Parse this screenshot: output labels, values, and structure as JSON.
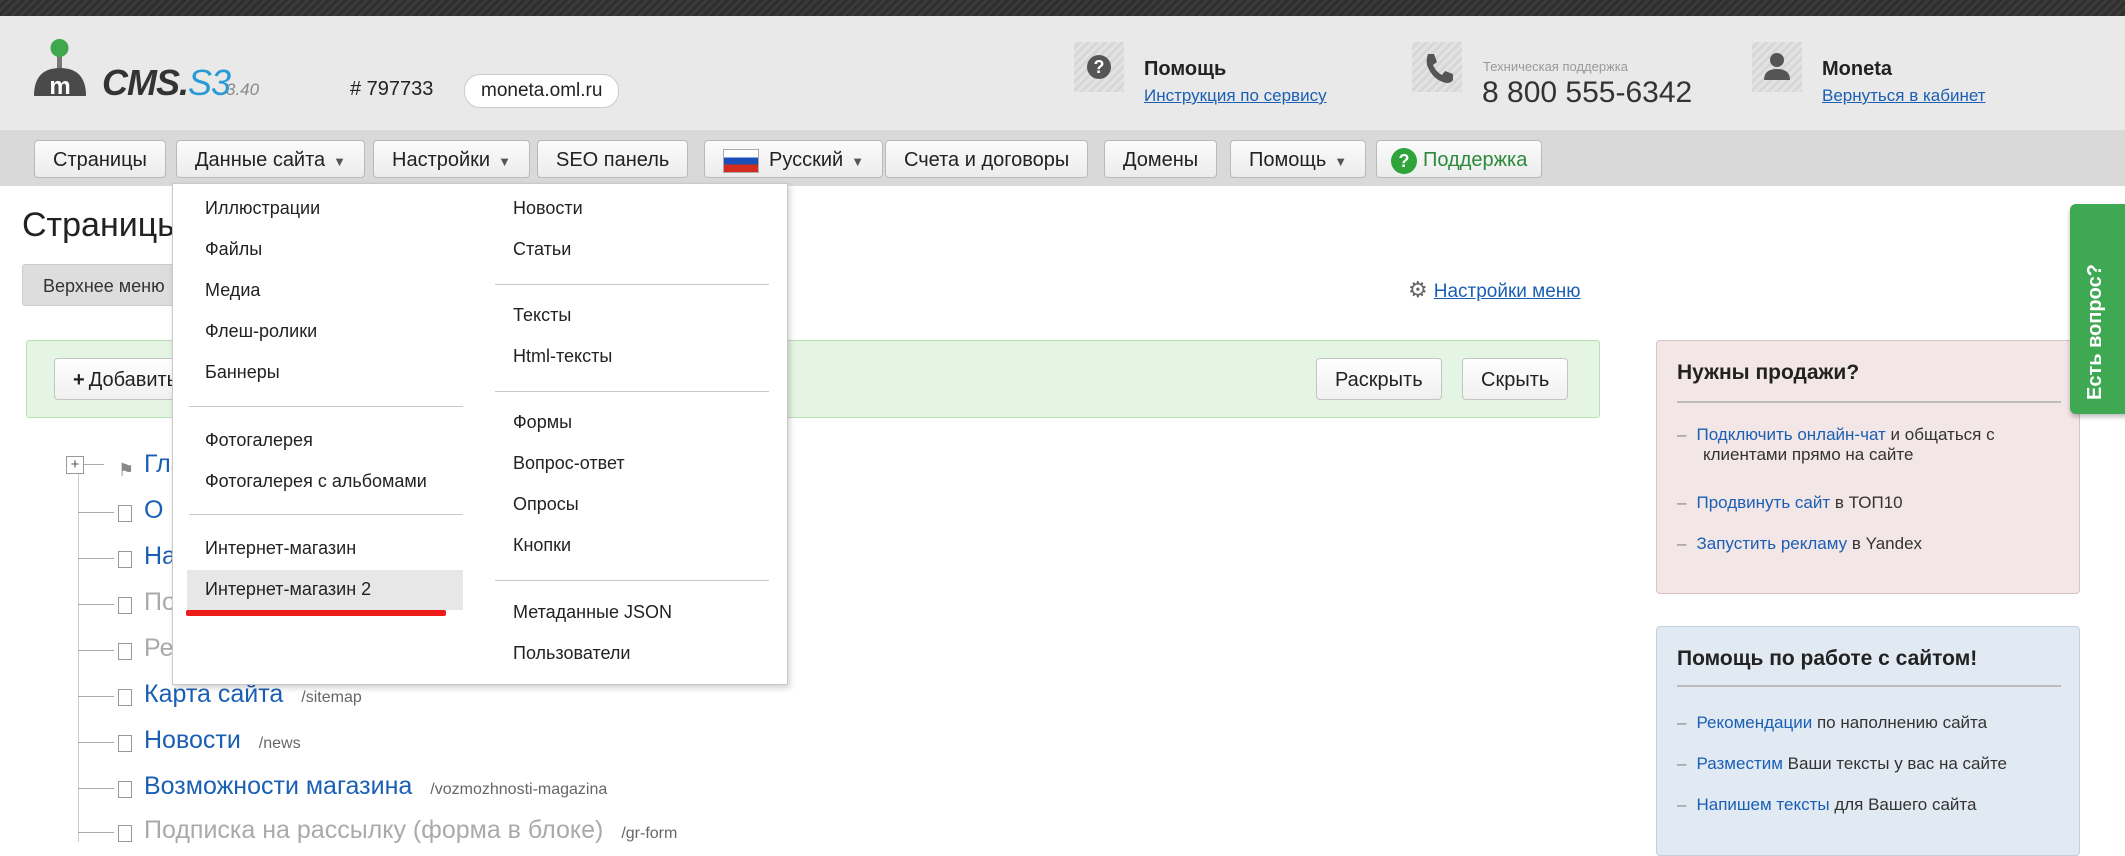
{
  "header": {
    "logo_text_main": "CMS.",
    "logo_text_s3": "S3",
    "version": "3.40",
    "site_id": "# 797733",
    "domain": "moneta.oml.ru",
    "help_title": "Помощь",
    "help_link": "Инструкция по сервису",
    "support_caption": "Техническая поддержка",
    "support_phone": "8 800 555-6342",
    "user_name": "Moneta",
    "user_link": "Вернуться в кабинет"
  },
  "nav": {
    "pages": "Страницы",
    "site_data": "Данные сайта",
    "settings": "Настройки",
    "seo": "SEO панель",
    "language": "Русский",
    "billing": "Счета и договоры",
    "domains": "Домены",
    "help": "Помощь",
    "support": "Поддержка"
  },
  "main": {
    "title": "Страницы",
    "tab_top_menu": "Верхнее меню",
    "menu_settings": "Настройки меню",
    "add_button": "Добавить",
    "expand_button": "Раскрыть",
    "collapse_button": "Скрыть"
  },
  "tree": [
    {
      "name": "Главная",
      "path": "",
      "muted": false
    },
    {
      "name": "О компании",
      "path": "",
      "muted": false
    },
    {
      "name": "Наши услуги",
      "path": "",
      "muted": false
    },
    {
      "name": "Поиск по сайту",
      "path": "",
      "muted": true
    },
    {
      "name": "Регистрация",
      "path": "",
      "muted": true
    },
    {
      "name": "Карта сайта",
      "path": "/sitemap",
      "muted": false
    },
    {
      "name": "Новости",
      "path": "/news",
      "muted": false
    },
    {
      "name": "Возможности магазина",
      "path": "/vozmozhnosti-magazina",
      "muted": false
    },
    {
      "name": "Подписка на рассылку (форма в блоке)",
      "path": "/gr-form",
      "muted": true
    }
  ],
  "dropdown": {
    "left": [
      "Иллюстрации",
      "Файлы",
      "Медиа",
      "Флеш-ролики",
      "Баннеры",
      "Фотогалерея",
      "Фотогалерея с альбомами",
      "Интернет-магазин",
      "Интернет-магазин 2"
    ],
    "right": [
      "Новости",
      "Статьи",
      "Тексты",
      "Html-тексты",
      "Формы",
      "Вопрос-ответ",
      "Опросы",
      "Кнопки",
      "Метаданные JSON",
      "Пользователи"
    ],
    "highlighted": "Интернет-магазин 2"
  },
  "sidebar": {
    "sales": {
      "title": "Нужны продажи?",
      "items": [
        {
          "link": "Подключить онлайн-чат",
          "text1": " и общаться с",
          "text2": "клиентами прямо на сайте"
        },
        {
          "link": "Продвинуть сайт",
          "text1": " в ТОП10",
          "text2": ""
        },
        {
          "link": "Запустить рекламу",
          "text1": " в Yandex",
          "text2": ""
        }
      ]
    },
    "help": {
      "title": "Помощь по работе с сайтом!",
      "items": [
        {
          "link": "Рекомендации",
          "text1": " по наполнению сайта"
        },
        {
          "link": "Разместим",
          "text1": " Ваши тексты у вас на сайте"
        },
        {
          "link": "Напишем тексты",
          "text1": " для Вашего сайта"
        }
      ]
    },
    "question_tab": "Есть вопрос?"
  },
  "colors": {
    "link": "#1a5fb4",
    "support_green": "#2ea43a",
    "annotation_red": "#ee1b1b",
    "sales_box_bg": "#f3e6e6",
    "help_box_bg": "#e1e9f2"
  }
}
